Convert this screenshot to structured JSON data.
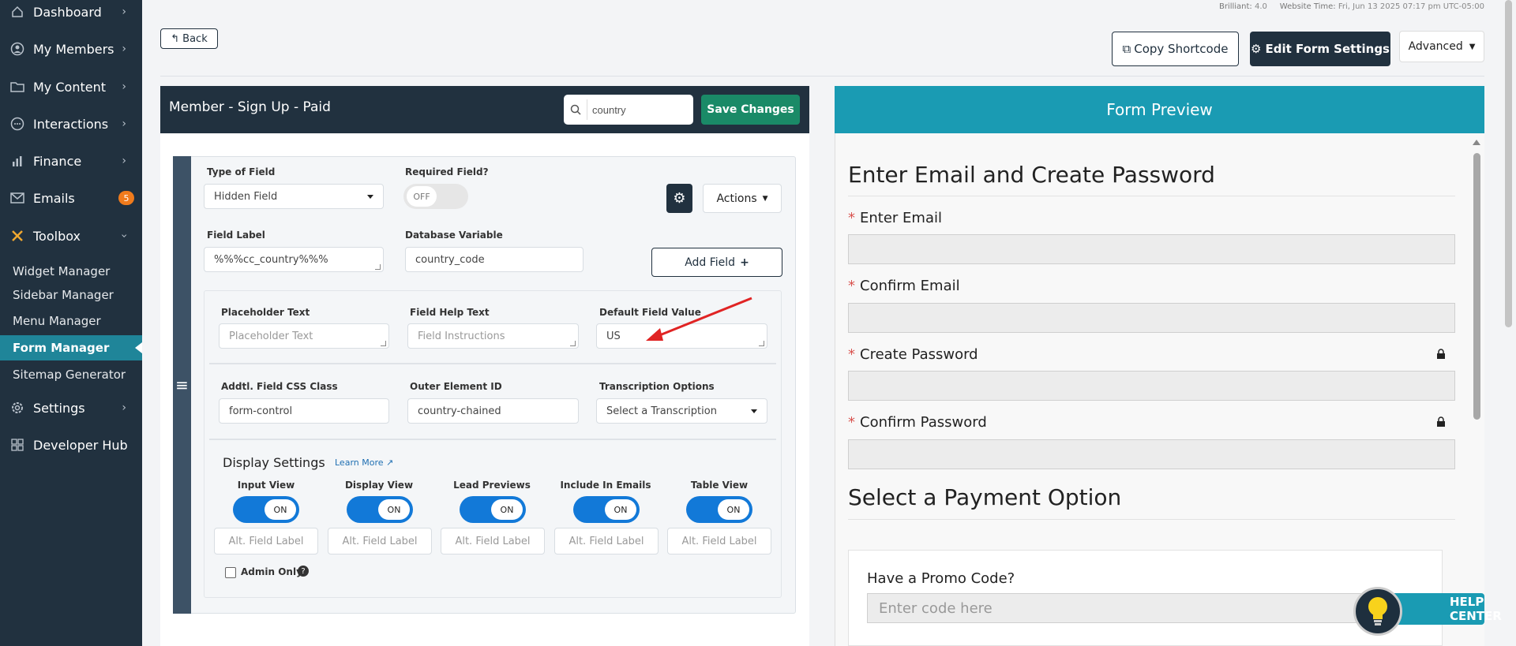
{
  "sidebar": {
    "items": [
      {
        "label": "Dashboard",
        "icon": "home-icon"
      },
      {
        "label": "My Members",
        "icon": "user-icon"
      },
      {
        "label": "My Content",
        "icon": "folder-icon"
      },
      {
        "label": "Interactions",
        "icon": "chat-icon"
      },
      {
        "label": "Finance",
        "icon": "chart-icon"
      },
      {
        "label": "Emails",
        "icon": "envelope-icon",
        "badge": "5"
      },
      {
        "label": "Toolbox",
        "icon": "tools-icon"
      },
      {
        "label": "Settings",
        "icon": "gear-icon"
      },
      {
        "label": "Developer Hub",
        "icon": "grid-icon"
      }
    ],
    "toolbox_items": [
      "Widget Manager",
      "Sidebar Manager",
      "Menu Manager",
      "Form Manager",
      "Sitemap Generator"
    ],
    "active_item": "Form Manager"
  },
  "header": {
    "version_label": "Brilliant:",
    "version_value": "4.0",
    "time_label": "Website Time:",
    "time_value": "Fri, Jun 13 2025 07:17 pm UTC-05:00",
    "back_label": "Back",
    "copy_label": "Copy Shortcode",
    "edit_label": "Edit Form Settings",
    "advanced_label": "Advanced"
  },
  "editor": {
    "title": "Member - Sign Up - Paid",
    "search_value": "country",
    "save_label": "Save Changes",
    "type_label": "Type of Field",
    "type_value": "Hidden Field",
    "required_label": "Required Field?",
    "required_toggle": "OFF",
    "actions_label": "Actions",
    "field_label_label": "Field Label",
    "field_label_value": "%%%cc_country%%%",
    "db_var_label": "Database Variable",
    "db_var_value": "country_code",
    "add_field_label": "Add Field",
    "placeholder_label": "Placeholder Text",
    "placeholder_placeholder": "Placeholder Text",
    "help_label": "Field Help Text",
    "help_placeholder": "Field Instructions",
    "default_label": "Default Field Value",
    "default_value": "US",
    "css_label": "Addtl. Field CSS Class",
    "css_value": "form-control",
    "outer_id_label": "Outer Element ID",
    "outer_id_value": "country-chained",
    "transcription_label": "Transcription Options",
    "transcription_value": "Select a Transcription",
    "display_title": "Display Settings",
    "learn_more": "Learn More",
    "display_columns": [
      {
        "label": "Input View",
        "toggle": "ON",
        "alt": "Alt. Field Label"
      },
      {
        "label": "Display View",
        "toggle": "ON",
        "alt": "Alt. Field Label"
      },
      {
        "label": "Lead Previews",
        "toggle": "ON",
        "alt": "Alt. Field Label"
      },
      {
        "label": "Include In Emails",
        "toggle": "ON",
        "alt": "Alt. Field Label"
      },
      {
        "label": "Table View",
        "toggle": "ON",
        "alt": "Alt. Field Label"
      }
    ],
    "admin_only_label": "Admin Only"
  },
  "preview": {
    "title": "Form Preview",
    "section1": "Enter Email and Create Password",
    "fields": [
      {
        "label": "Enter Email",
        "locked": false
      },
      {
        "label": "Confirm Email",
        "locked": false
      },
      {
        "label": "Create Password",
        "locked": true
      },
      {
        "label": "Confirm Password",
        "locked": true
      }
    ],
    "section2": "Select a Payment Option",
    "promo_label": "Have a Promo Code?",
    "promo_placeholder": "Enter code here"
  },
  "help": {
    "label": "HELP CENTER"
  },
  "colors": {
    "sidebar": "#21313f",
    "active": "#1f8599",
    "save": "#1a8a67",
    "preview_header": "#1a9bb3",
    "toggle_on": "#1279d8",
    "badge": "#f07b1c",
    "annotation_arrow": "#e02424"
  }
}
